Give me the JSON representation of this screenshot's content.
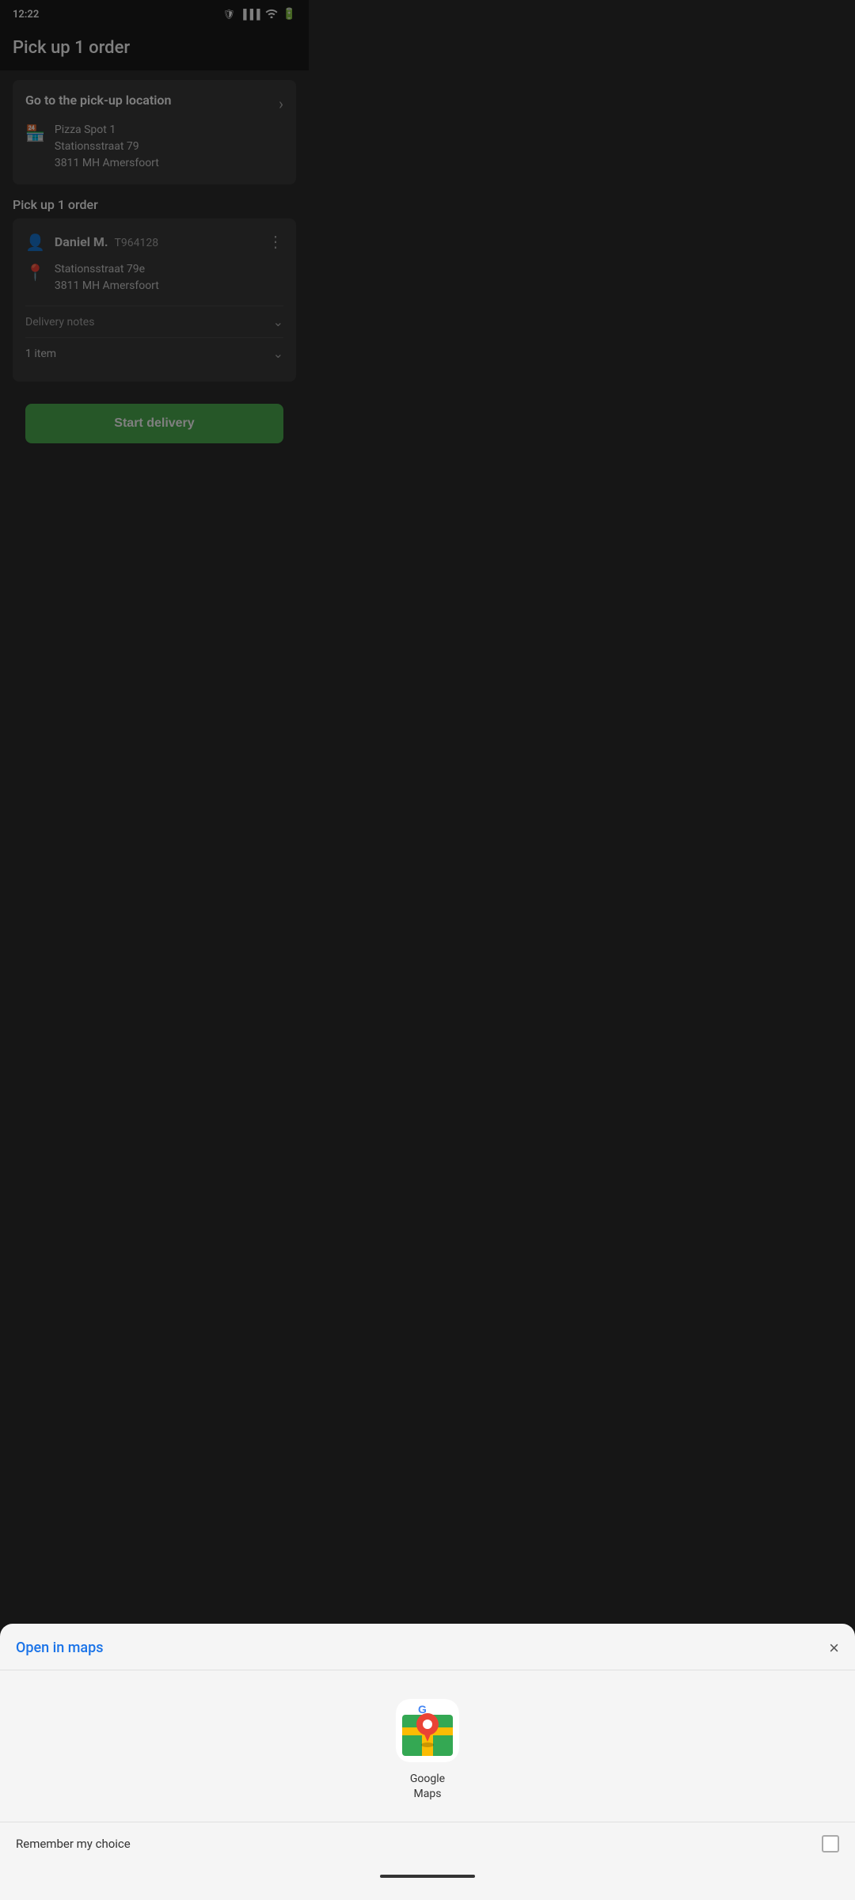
{
  "statusBar": {
    "time": "12:22",
    "icons": [
      "signal",
      "wifi",
      "battery"
    ]
  },
  "header": {
    "title": "Pick up 1 order"
  },
  "pickupCard": {
    "heading": "Go to the pick-up location",
    "restaurantName": "Pizza Spot 1",
    "addressLine1": "Stationsstraat 79",
    "addressLine2": "3811 MH Amersfoort"
  },
  "orderSection": {
    "label": "Pick up 1 order"
  },
  "orderCard": {
    "customerName": "Daniel M.",
    "orderId": "T964128",
    "addressLine1": "Stationsstraat 79e",
    "addressLine2": "3811 MH  Amersfoort",
    "deliveryNotesLabel": "Delivery notes",
    "itemsLabel": "1 item"
  },
  "startDeliveryButton": "Start delivery",
  "bottomSheet": {
    "title": "Open in maps",
    "closeLabel": "×",
    "mapsAppName": "Google",
    "mapsAppLine2": "Maps",
    "rememberLabel": "Remember my choice"
  }
}
